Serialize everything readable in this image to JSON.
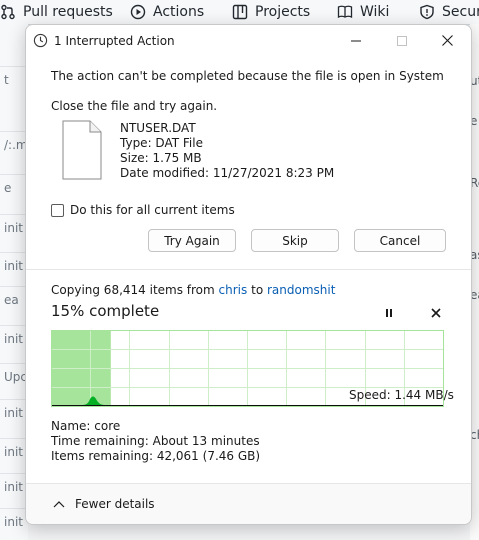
{
  "background": {
    "nav_tabs": [
      {
        "label": "Pull requests",
        "icon": "pull-request-icon"
      },
      {
        "label": "Actions",
        "icon": "play-icon"
      },
      {
        "label": "Projects",
        "icon": "table-icon"
      },
      {
        "label": "Wiki",
        "icon": "book-icon"
      },
      {
        "label": "Securi",
        "icon": "shield-icon"
      }
    ],
    "left_rows": [
      "t",
      "/:.mo",
      "e",
      "init",
      "init",
      "init",
      "ea",
      "init",
      "Upc",
      "init",
      "init",
      "init",
      "init"
    ],
    "right_frags": [
      "ut",
      "e",
      "Re",
      "as",
      "ea",
      "",
      "ch"
    ]
  },
  "dialog": {
    "title": "1 Interrupted Action",
    "message": "The action can't be completed because the file is open in System",
    "instruction": "Close the file and try again.",
    "file": {
      "name": "NTUSER.DAT",
      "type": "Type: DAT File",
      "size": "Size: 1.75 MB",
      "date_modified": "Date modified: 11/27/2021 8:23 PM"
    },
    "checkbox_label": "Do this for all current items",
    "buttons": {
      "try_again": "Try Again",
      "skip": "Skip",
      "cancel": "Cancel"
    },
    "progress": {
      "copying_prefix": "Copying 68,414 items from",
      "source": "chris",
      "to_word": "to",
      "destination": "randomshit",
      "percent_text": "15% complete",
      "percent": 15,
      "speed": "Speed: 1.44 MB/s",
      "accent_color": "#06b025",
      "fill_color": "#a6e39b"
    },
    "details": {
      "name": "Name:  core",
      "time_remaining": "Time remaining:  About 13 minutes",
      "items_remaining": "Items remaining:  42,061 (7.46 GB)"
    },
    "fewer_details": "Fewer details"
  }
}
